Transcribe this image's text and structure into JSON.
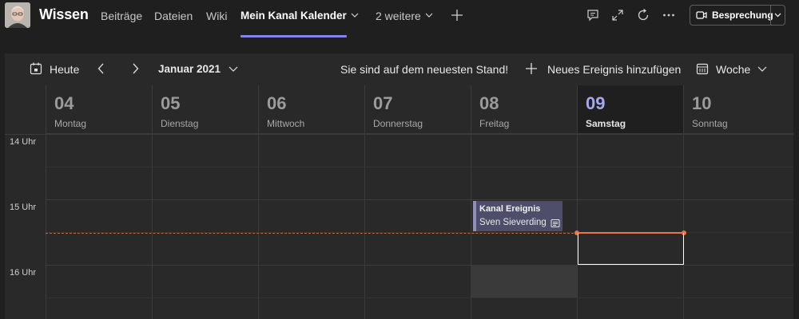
{
  "header": {
    "team_name": "Wissen",
    "tabs": [
      {
        "label": "Beiträge"
      },
      {
        "label": "Dateien"
      },
      {
        "label": "Wiki"
      },
      {
        "label": "Mein Kanal Kalender"
      },
      {
        "label": "2 weitere"
      }
    ],
    "meet_button": "Besprechung",
    "icons": [
      "chat-icon",
      "expand-icon",
      "refresh-icon",
      "more-icon"
    ]
  },
  "toolbar": {
    "today": "Heute",
    "month": "Januar 2021",
    "status": "Sie sind auf dem neuesten Stand!",
    "add_event": "Neues Ereignis hinzufügen",
    "view": "Woche"
  },
  "days": [
    {
      "num": "04",
      "name": "Montag"
    },
    {
      "num": "05",
      "name": "Dienstag"
    },
    {
      "num": "06",
      "name": "Mittwoch"
    },
    {
      "num": "07",
      "name": "Donnerstag"
    },
    {
      "num": "08",
      "name": "Freitag"
    },
    {
      "num": "09",
      "name": "Samstag"
    },
    {
      "num": "10",
      "name": "Sonntag"
    }
  ],
  "today_index": 5,
  "hours": [
    "14 Uhr",
    "15 Uhr",
    "16 Uhr"
  ],
  "event": {
    "title": "Kanal Ereignis",
    "organizer": "Sven Sieverding"
  },
  "colors": {
    "accent": "#7f85f5",
    "now_line": "#e97548",
    "event_bg": "#4e4e6a",
    "event_border": "#8f8fb9"
  }
}
